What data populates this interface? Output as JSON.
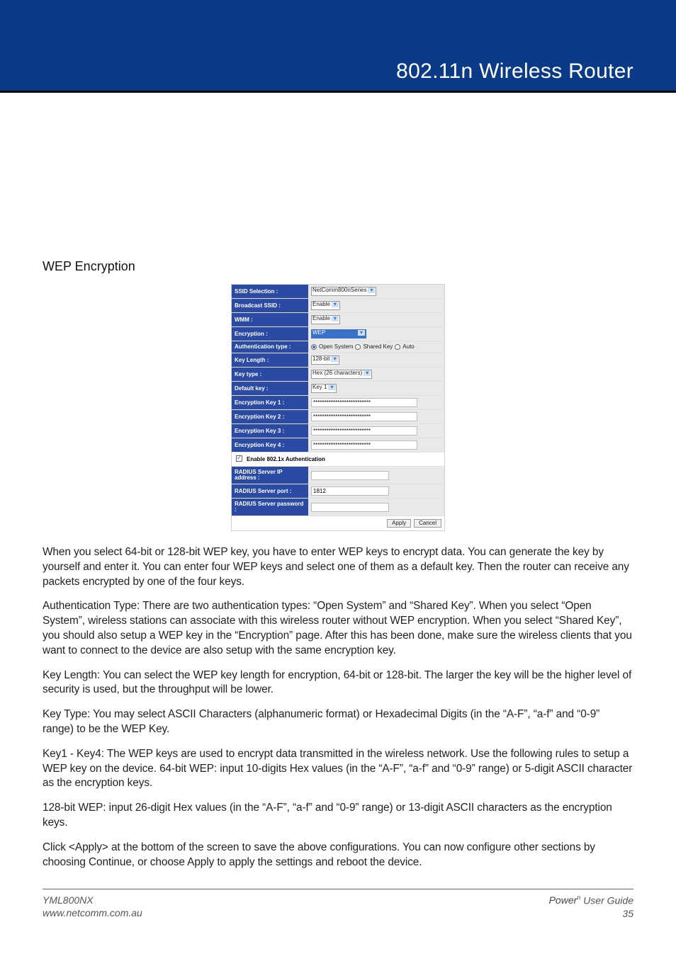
{
  "header": {
    "title": "802.11n Wireless Router"
  },
  "section": {
    "heading": "WEP Encryption"
  },
  "config": {
    "rows": {
      "ssid_sel": {
        "label": "SSID Selection :",
        "value": "NetComm800nSeries"
      },
      "bcast": {
        "label": "Broadcast SSID :",
        "value": "Enable"
      },
      "wmm": {
        "label": "WMM :",
        "value": "Enable"
      },
      "enc": {
        "label": "Encryption :",
        "value": "WEP"
      },
      "auth": {
        "label": "Authentication type :",
        "opt1": "Open System",
        "opt2": "Shared Key",
        "opt3": "Auto"
      },
      "klen": {
        "label": "Key Length :",
        "value": "128-bit"
      },
      "ktype": {
        "label": "Key type :",
        "value": "Hex (26 characters)"
      },
      "defkey": {
        "label": "Default key :",
        "value": "Key 1"
      },
      "k1": {
        "label": "Encryption Key 1 :",
        "value": "**************************"
      },
      "k2": {
        "label": "Encryption Key 2 :",
        "value": "**************************"
      },
      "k3": {
        "label": "Encryption Key 3 :",
        "value": "**************************"
      },
      "k4": {
        "label": "Encryption Key 4 :",
        "value": "**************************"
      },
      "enable8021x": {
        "label": "Enable 802.1x Authentication"
      },
      "radius_ip": {
        "label": "RADIUS Server IP address :",
        "value": ""
      },
      "radius_port": {
        "label": "RADIUS Server port :",
        "value": "1812"
      },
      "radius_pw": {
        "label": "RADIUS Server password :",
        "value": ""
      }
    },
    "buttons": {
      "apply": "Apply",
      "cancel": "Cancel"
    }
  },
  "body": {
    "intro": "When you select 64-bit or 128-bit WEP key, you have to enter WEP keys to encrypt data. You can generate the key by yourself and enter it. You can enter four WEP keys and select one of them as a default key. Then the router can receive any packets encrypted by one of the four keys.",
    "auth_lbl": "Authentication Type",
    "auth_txt": ": There are two authentication types: “Open System” and “Shared Key”. When you select “Open System”, wireless stations can associate with this wireless router without WEP encryption. When you select “Shared Key”, you should also setup a WEP key in the “Encryption” page. After this has been done, make sure the wireless clients that you want to connect to the device are also setup with the same encryption key.",
    "klen_lbl": "Key Length",
    "klen_txt": ": You can select the WEP key length for encryption, 64-bit or 128-bit. The larger the key will be the higher level of security is used, but the throughput will be lower.",
    "ktype_lbl": "Key Type",
    "ktype_txt": ": You may select ASCII Characters (alphanumeric format) or Hexadecimal Digits (in the “A-F”, “a-f” and “0-9” range) to be the WEP Key.",
    "k14_lbl": "Key1 - Key4",
    "k14_txt": ": The WEP keys are used to encrypt data transmitted in the wireless network. Use the following rules to setup a WEP key on the device. 64-bit WEP: input 10-digits Hex values (in the “A-F”, “a-f” and “0-9” range) or 5-digit ASCII character as the encryption keys.",
    "k128_lbl": "128-bit WEP",
    "k128_txt": ": input 26-digit Hex values (in the “A-F”, “a-f” and “0-9” range) or 13-digit ASCII characters as the encryption keys.",
    "apply_txt": "Click <Apply> at the bottom of the screen to save the above configurations. You can now configure other sections by choosing Continue, or choose Apply to apply the settings and reboot the device."
  },
  "footer": {
    "model": "YML800NX",
    "url": "www.netcomm.com.au",
    "brand": "Power",
    "brand_sup": "n",
    "guide": " User Guide",
    "page": "35"
  }
}
